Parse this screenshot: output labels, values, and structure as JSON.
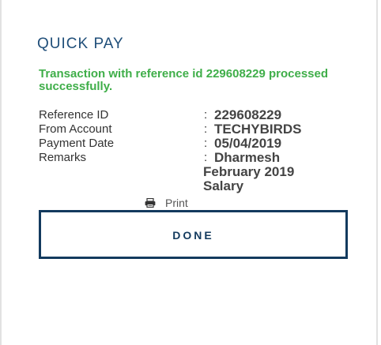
{
  "quick_pay": {
    "title": "QUICK PAY",
    "success_message": "Transaction with reference id 229608229 processed successfully.",
    "details": [
      {
        "label": "Reference ID",
        "colon": ":",
        "value": "229608229"
      },
      {
        "label": "From Account",
        "colon": ":",
        "value": "TECHYBIRDS"
      },
      {
        "label": "Payment Date",
        "colon": ":",
        "value": "05/04/2019"
      },
      {
        "label": "Remarks",
        "colon": ":",
        "value": "Dharmesh February 2019 Salary"
      }
    ],
    "print_label": "Print",
    "print_icon": "printer-icon",
    "done_label": "DONE"
  },
  "colors": {
    "title": "#1f4e79",
    "success": "#3fae49",
    "button_border": "#133a5e"
  }
}
